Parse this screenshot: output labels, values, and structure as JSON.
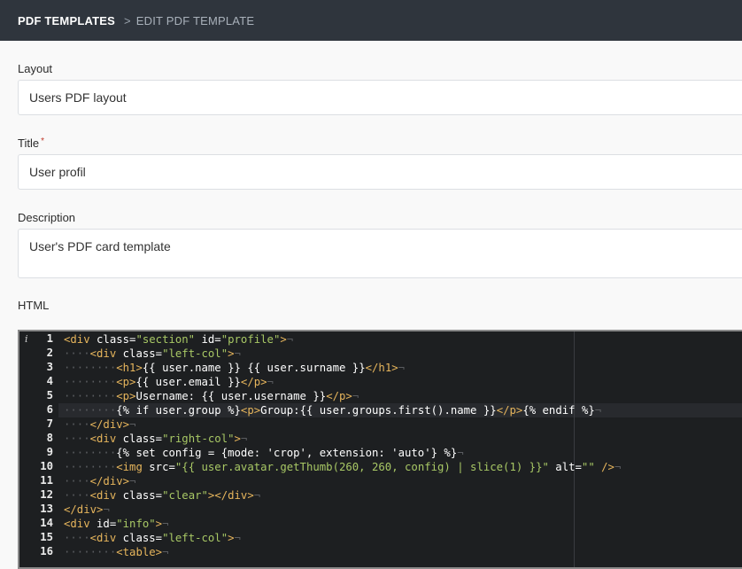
{
  "breadcrumb": {
    "root": "PDF TEMPLATES",
    "separator": ">",
    "current": "EDIT PDF TEMPLATE"
  },
  "form": {
    "layout": {
      "label": "Layout",
      "value": "Users PDF layout"
    },
    "title": {
      "label": "Title",
      "required_mark": "*",
      "value": "User profil"
    },
    "description": {
      "label": "Description",
      "value": "User's PDF card template"
    },
    "html": {
      "label": "HTML",
      "info_icon": "i"
    }
  },
  "code_lines": [
    "<div class=\"section\" id=\"profile\">",
    "    <div class=\"left-col\">",
    "        <h1>{{ user.name }} {{ user.surname }}</h1>",
    "        <p>{{ user.email }}</p>",
    "        <p>Username: {{ user.username }}</p>",
    "        {% if user.group %}<p>Group:{{ user.groups.first().name }}</p>{% endif %}",
    "    </div>",
    "    <div class=\"right-col\">",
    "        {% set config = {mode: 'crop', extension: 'auto'} %}",
    "        <img src=\"{{ user.avatar.getThumb(260, 260, config) | slice(1) }}\" alt=\"\" />",
    "    </div>",
    "    <div class=\"clear\"></div>",
    "</div>",
    "<div id=\"info\">",
    "    <div class=\"left-col\">",
    "        <table>"
  ],
  "code_line_numbers": [
    "1",
    "2",
    "3",
    "4",
    "5",
    "6",
    "7",
    "8",
    "9",
    "10",
    "11",
    "12",
    "13",
    "14",
    "15",
    "16"
  ],
  "active_line": 6,
  "colors": {
    "topbar": "#2f353d",
    "editor_bg": "#1d1f21",
    "tag": "#e6b55c",
    "string": "#a8c865",
    "required": "#c0392b"
  }
}
